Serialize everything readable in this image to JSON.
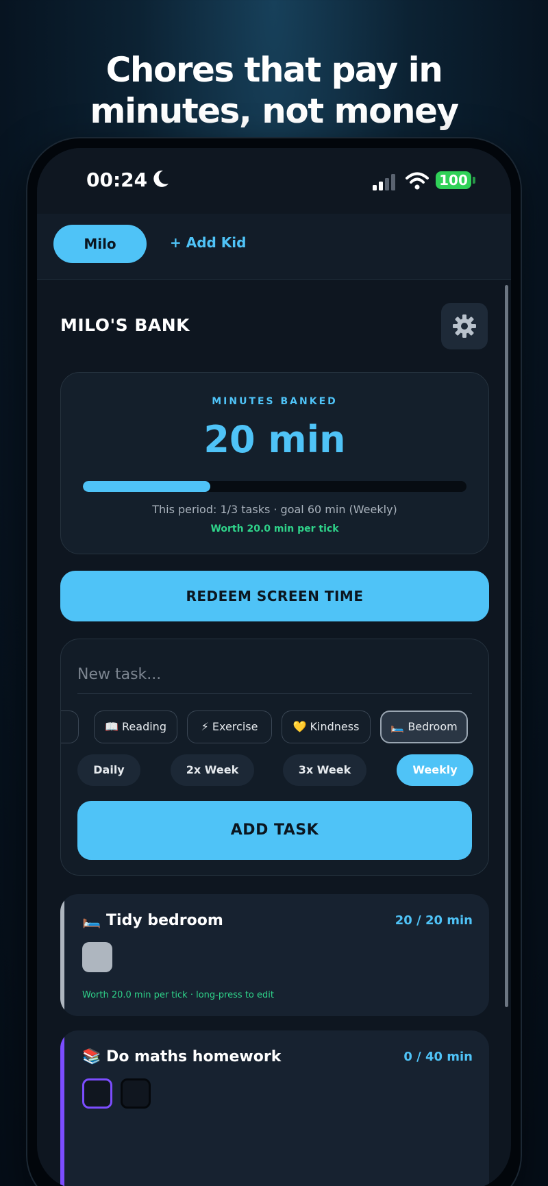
{
  "headline": {
    "line1": "Chores that pay in",
    "line2": "minutes, not money"
  },
  "status_bar": {
    "time": "00:24",
    "battery": "100"
  },
  "kids": {
    "selected": "Milo",
    "add_label": "+ Add Kid"
  },
  "bank": {
    "title": "MILO'S BANK",
    "minutes_label": "MINUTES BANKED",
    "minutes_value": "20 min",
    "progress_fraction": 0.333,
    "period_text": "This period: 1/3 tasks · goal 60 min (Weekly)",
    "worth_text": "Worth 20.0 min per tick"
  },
  "redeem_label": "REDEEM SCREEN TIME",
  "new_task": {
    "placeholder": "New task...",
    "categories": [
      {
        "label": "📖 Reading",
        "selected": false
      },
      {
        "label": "⚡ Exercise",
        "selected": false
      },
      {
        "label": "💛 Kindness",
        "selected": false
      },
      {
        "label": "🛏️ Bedroom",
        "selected": true
      }
    ],
    "frequencies": [
      {
        "label": "Daily",
        "active": false
      },
      {
        "label": "2x Week",
        "active": false
      },
      {
        "label": "3x Week",
        "active": false
      },
      {
        "label": "Weekly",
        "active": true
      }
    ],
    "add_label": "ADD TASK"
  },
  "chores": [
    {
      "name": "🛏️ Tidy bedroom",
      "minutes": "20 / 20 min",
      "note": "Worth 20.0 min per tick · long-press to edit",
      "accent": "#aeb6bf"
    },
    {
      "name": "📚 Do maths homework",
      "minutes": "0 / 40 min",
      "accent": "#7c4dff"
    }
  ],
  "colors": {
    "accent": "#4fc3f7",
    "success": "#2fd38a",
    "purple": "#7c4dff"
  }
}
